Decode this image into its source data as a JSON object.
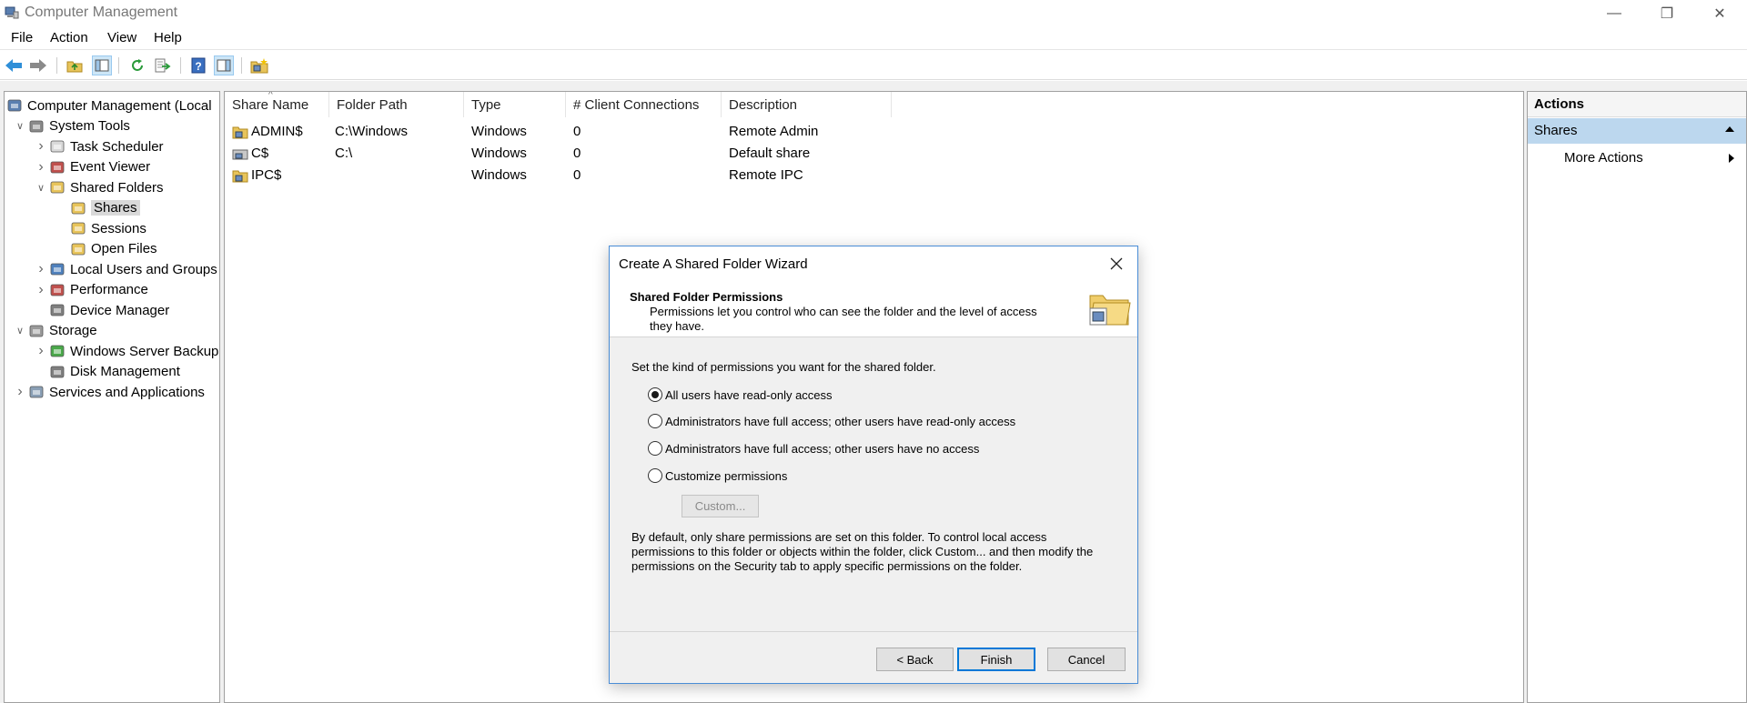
{
  "window": {
    "title": "Computer Management",
    "minimize_glyph": "—",
    "restore_glyph": "❐",
    "close_glyph": "✕"
  },
  "menu": [
    "File",
    "Action",
    "View",
    "Help"
  ],
  "toolbar_icons": [
    "back-arrow-icon",
    "forward-arrow-icon",
    "up-folder-icon",
    "show-hide-console-tree-icon",
    "refresh-icon",
    "export-list-icon",
    "help-icon",
    "show-hide-action-pane-icon",
    "new-share-icon"
  ],
  "tree": {
    "items": [
      {
        "label": "Computer Management (Local",
        "level": 0,
        "expand": "",
        "icon": "computer-management-icon"
      },
      {
        "label": "System Tools",
        "level": 1,
        "expand": "v",
        "icon": "system-tools-icon"
      },
      {
        "label": "Task Scheduler",
        "level": 2,
        "expand": ">",
        "icon": "clock-icon"
      },
      {
        "label": "Event Viewer",
        "level": 2,
        "expand": ">",
        "icon": "event-viewer-icon"
      },
      {
        "label": "Shared Folders",
        "level": 2,
        "expand": "v",
        "icon": "shared-folder-icon"
      },
      {
        "label": "Shares",
        "level": 3,
        "expand": "",
        "icon": "shares-icon",
        "selected": true
      },
      {
        "label": "Sessions",
        "level": 3,
        "expand": "",
        "icon": "sessions-icon"
      },
      {
        "label": "Open Files",
        "level": 3,
        "expand": "",
        "icon": "open-files-icon"
      },
      {
        "label": "Local Users and Groups",
        "level": 2,
        "expand": ">",
        "icon": "users-icon"
      },
      {
        "label": "Performance",
        "level": 2,
        "expand": ">",
        "icon": "performance-icon"
      },
      {
        "label": "Device Manager",
        "level": 2,
        "expand": "",
        "icon": "device-manager-icon"
      },
      {
        "label": "Storage",
        "level": 1,
        "expand": "v",
        "icon": "storage-icon"
      },
      {
        "label": "Windows Server Backup",
        "level": 2,
        "expand": ">",
        "icon": "backup-icon"
      },
      {
        "label": "Disk Management",
        "level": 2,
        "expand": "",
        "icon": "disk-management-icon"
      },
      {
        "label": "Services and Applications",
        "level": 1,
        "expand": ">",
        "icon": "services-icon"
      }
    ]
  },
  "shares_table": {
    "columns": [
      "Share Name",
      "Folder Path",
      "Type",
      "# Client Connections",
      "Description"
    ],
    "rows": [
      {
        "name": "ADMIN$",
        "path": "C:\\Windows",
        "type": "Windows",
        "connections": "0",
        "description": "Remote Admin"
      },
      {
        "name": "C$",
        "path": "C:\\",
        "type": "Windows",
        "connections": "0",
        "description": "Default share"
      },
      {
        "name": "IPC$",
        "path": "",
        "type": "Windows",
        "connections": "0",
        "description": "Remote IPC"
      }
    ]
  },
  "actions": {
    "header": "Actions",
    "section": "Shares",
    "more_actions": "More Actions"
  },
  "dialog": {
    "title": "Create A Shared Folder Wizard",
    "header_title": "Shared Folder Permissions",
    "header_desc": "Permissions let you control who can see the folder and the level of access they have.",
    "intro": "Set the kind of permissions you want for the shared folder.",
    "options": [
      {
        "label": "All users have read-only access",
        "checked": true
      },
      {
        "label": "Administrators have full access; other users have read-only access",
        "checked": false
      },
      {
        "label": "Administrators have full access; other users have no access",
        "checked": false
      },
      {
        "label": "Customize permissions",
        "checked": false
      }
    ],
    "custom_button": "Custom...",
    "note": "By default, only share permissions are set on this folder. To control local access permissions to this folder or objects within the folder, click Custom... and then modify the permissions on the Security tab to apply specific permissions on the folder.",
    "back_button": "< Back",
    "finish_button": "Finish",
    "cancel_button": "Cancel"
  }
}
